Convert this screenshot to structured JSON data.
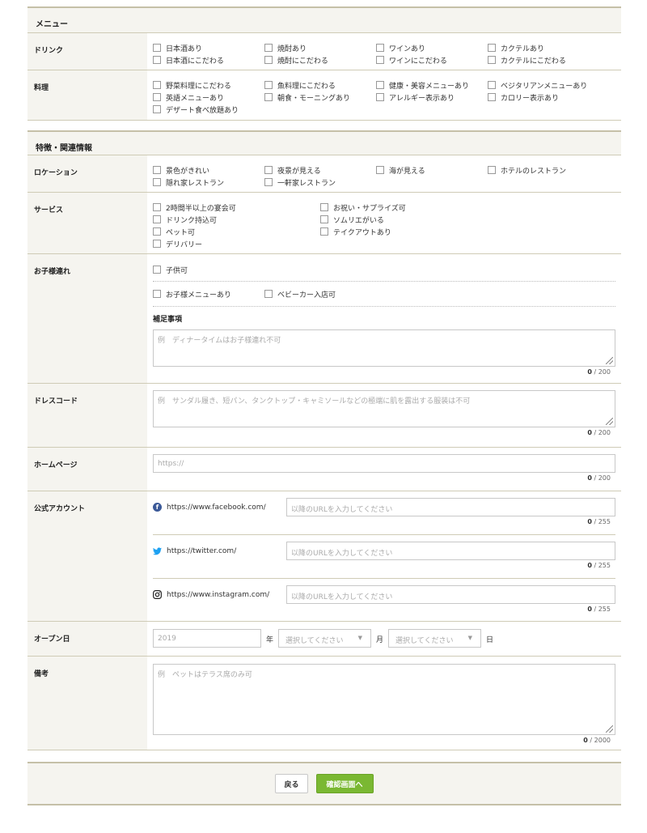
{
  "menu_section": {
    "title": "メニュー",
    "drink": {
      "label": "ドリンク",
      "options": [
        "日本酒あり",
        "焼酎あり",
        "ワインあり",
        "カクテルあり",
        "日本酒にこだわる",
        "焼酎にこだわる",
        "ワインにこだわる",
        "カクテルにこだわる"
      ]
    },
    "food": {
      "label": "料理",
      "options": [
        "野菜料理にこだわる",
        "魚料理にこだわる",
        "健康・美容メニューあり",
        "ベジタリアンメニューあり",
        "英語メニューあり",
        "朝食・モーニングあり",
        "アレルギー表示あり",
        "カロリー表示あり",
        "デザート食べ放題あり"
      ]
    }
  },
  "features_section": {
    "title": "特徴・関連情報",
    "location": {
      "label": "ロケーション",
      "options": [
        "景色がきれい",
        "夜景が見える",
        "海が見える",
        "ホテルのレストラン",
        "隠れ家レストラン",
        "一軒家レストラン"
      ]
    },
    "service": {
      "label": "サービス",
      "options": [
        "2時間半以上の宴会可",
        "お祝い・サプライズ可",
        "ドリンク持込可",
        "ソムリエがいる",
        "ペット可",
        "テイクアウトあり",
        "デリバリー"
      ]
    },
    "kids": {
      "label": "お子様連れ",
      "option_main": "子供可",
      "options_sub": [
        "お子様メニューあり",
        "ベビーカー入店可"
      ],
      "note_title": "補足事項",
      "note_placeholder": "例　ディナータイムはお子様連れ不可",
      "note_count": "0",
      "note_max": " / 200"
    },
    "dresscode": {
      "label": "ドレスコード",
      "placeholder": "例　サンダル履き、短パン、タンクトップ・キャミソールなどの極端に肌を露出する服装は不可",
      "count": "0",
      "max": " / 200"
    },
    "homepage": {
      "label": "ホームページ",
      "placeholder": "https://",
      "count": "0",
      "max": " / 200"
    },
    "accounts": {
      "label": "公式アカウント",
      "items": [
        {
          "icon": "facebook-icon",
          "prefix": "https://www.facebook.com/",
          "placeholder": "以降のURLを入力してください",
          "count": "0",
          "max": " / 255"
        },
        {
          "icon": "twitter-icon",
          "prefix": "https://twitter.com/",
          "placeholder": "以降のURLを入力してください",
          "count": "0",
          "max": " / 255"
        },
        {
          "icon": "instagram-icon",
          "prefix": "https://www.instagram.com/",
          "placeholder": "以降のURLを入力してください",
          "count": "0",
          "max": " / 255"
        }
      ]
    },
    "open_date": {
      "label": "オープン日",
      "year_placeholder": "2019",
      "year_unit": "年",
      "month_placeholder": "選択してください",
      "month_unit": "月",
      "day_placeholder": "選択してください",
      "day_unit": "日"
    },
    "remarks": {
      "label": "備考",
      "placeholder": "例　ペットはテラス席のみ可",
      "count": "0",
      "max": " / 2000"
    }
  },
  "footer": {
    "back_label": "戻る",
    "confirm_label": "確認画面へ"
  },
  "colors": {
    "label_bg": "#f5f4ef",
    "rule": "#c5c0a8",
    "confirm_green": "#7ab832"
  }
}
